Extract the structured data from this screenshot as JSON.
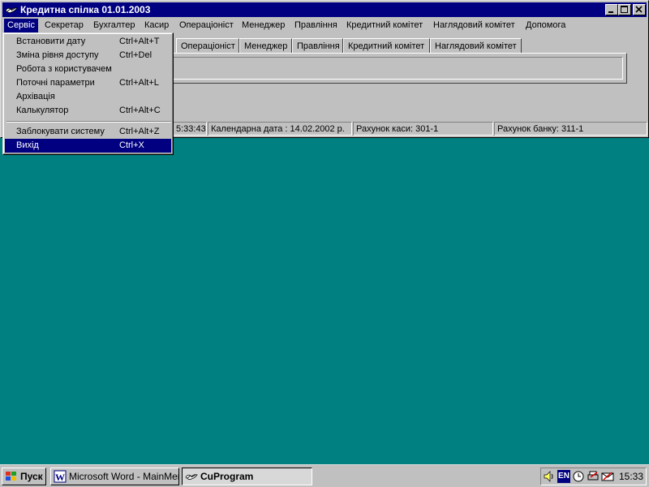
{
  "window": {
    "title": "Кредитна спілка 01.01.2003"
  },
  "menubar": {
    "items": [
      "Сервіс",
      "Секретар",
      "Бухгалтер",
      "Касир",
      "Операціоніст",
      "Менеджер",
      "Правління",
      "Кредитний комітет",
      "Наглядовий комітет",
      "Допомога"
    ]
  },
  "tabs": [
    "Операціоніст",
    "Менеджер",
    "Правління",
    "Кредитний комітет",
    "Наглядовий комітет"
  ],
  "statusbar": {
    "time": "5:33:43",
    "calendar_date": "Календарна дата : 14.02.2002 р.",
    "cash_account": "Рахунок каси: 301-1",
    "bank_account": "Рахунок банку: 311-1"
  },
  "service_menu": {
    "items": [
      {
        "label": "Встановити дату",
        "shortcut": "Ctrl+Alt+T"
      },
      {
        "label": "Зміна рівня доступу",
        "shortcut": "Ctrl+Del"
      },
      {
        "label": "Робота з користувачем",
        "shortcut": ""
      },
      {
        "label": "Поточні параметри",
        "shortcut": "Ctrl+Alt+L"
      },
      {
        "label": "Архівація",
        "shortcut": ""
      },
      {
        "label": "Калькулятор",
        "shortcut": "Ctrl+Alt+C"
      },
      {
        "label": "Заблокувати систему",
        "shortcut": "Ctrl+Alt+Z"
      },
      {
        "label": "Вихід",
        "shortcut": "Ctrl+X"
      }
    ],
    "selected": "Вихід"
  },
  "taskbar": {
    "start_label": "Пуск",
    "tasks": [
      "Microsoft Word - MainMen...",
      "CuProgram"
    ],
    "active_task": "CuProgram",
    "language": "EN",
    "clock": "15:33"
  },
  "colors": {
    "desktop": "#008080",
    "titlebar": "#000080",
    "face": "#c0c0c0",
    "highlight": "#000080"
  },
  "icons": {
    "app": "cu-logo-icon",
    "start": "windows-flag-icon",
    "word": "word-icon",
    "tray": [
      "speaker-icon",
      "language-icon",
      "task-scheduler-icon",
      "printer-icon",
      "mail-icon"
    ]
  }
}
